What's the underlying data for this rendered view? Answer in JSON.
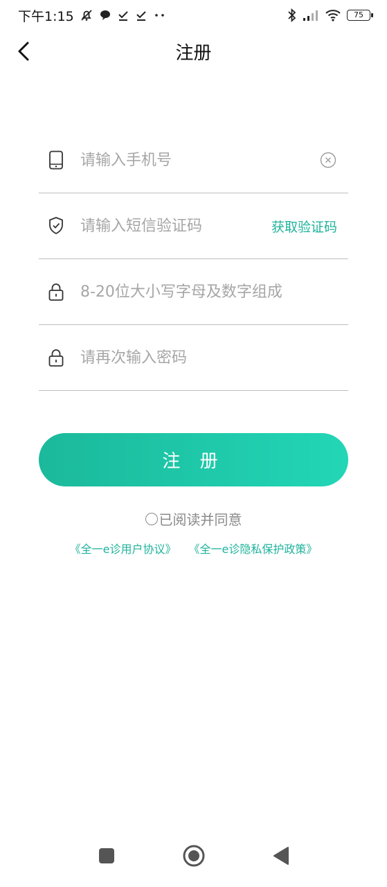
{
  "status_bar": {
    "time": "下午1:15",
    "battery": "75",
    "icons": [
      "mute-bell-icon",
      "chat-bubble-icon",
      "check-icon",
      "check-icon",
      "dots-icon",
      "bluetooth-icon",
      "signal-icon",
      "wifi-icon",
      "battery-icon"
    ]
  },
  "nav": {
    "title": "注册",
    "back_icon": "chevron-left-icon"
  },
  "form": {
    "phone_placeholder": "请输入手机号",
    "code_placeholder": "请输入短信验证码",
    "get_code_label": "获取验证码",
    "password_placeholder": "8-20位大小写字母及数字组成",
    "confirm_placeholder": "请再次输入密码"
  },
  "register_label": "注 册",
  "agreement": {
    "text": "已阅读并同意",
    "user_agreement": "《全一e诊用户协议》",
    "privacy_policy": "《全一e诊隐私保护政策》"
  },
  "colors": {
    "accent": "#1fb39c",
    "button_start": "#1bb99b",
    "button_end": "#22d6b6"
  }
}
